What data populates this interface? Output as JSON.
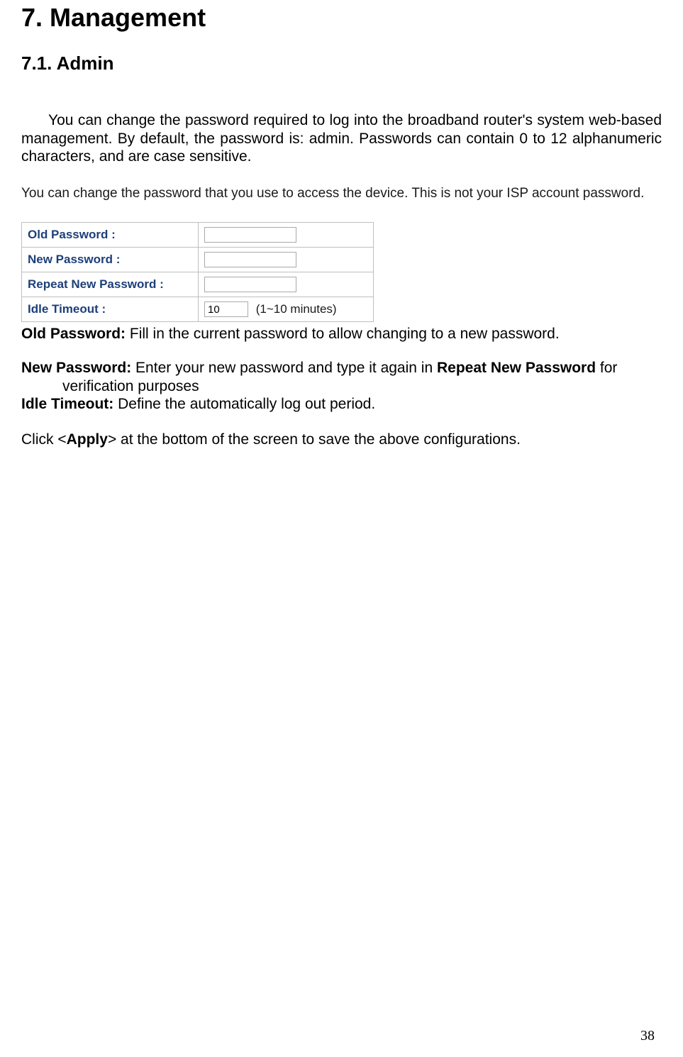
{
  "headings": {
    "h1": "7. Management",
    "h2": "7.1. Admin"
  },
  "intro": "You can change the password required to log into the broadband router's system web-based management. By default, the password is: admin. Passwords can contain 0 to 12 alphanumeric characters, and are case sensitive.",
  "ui": {
    "desc": "You can change the password that you use to access the device. This is not your ISP account password.",
    "rows": {
      "old_password": {
        "label": "Old Password :",
        "value": ""
      },
      "new_password": {
        "label": "New Password :",
        "value": ""
      },
      "repeat_password": {
        "label": "Repeat New Password :",
        "value": ""
      },
      "idle_timeout": {
        "label": "Idle Timeout :",
        "value": "10",
        "suffix": "(1~10 minutes)"
      }
    }
  },
  "descriptions": {
    "old_pw_label": "Old Password:",
    "old_pw_text": " Fill in the current password to allow changing to a new password.",
    "new_pw_label": "New Password:",
    "new_pw_text_a": " Enter your new password and type it again in ",
    "new_pw_bold": "Repeat New Password",
    "new_pw_text_b": " for",
    "new_pw_line2": "verification purposes",
    "idle_label": "Idle Timeout:",
    "idle_text": " Define the automatically log out period.",
    "apply_pre": "Click <",
    "apply_bold": "Apply",
    "apply_post": "> at the bottom of the screen to save the above configurations."
  },
  "page_number": "38"
}
